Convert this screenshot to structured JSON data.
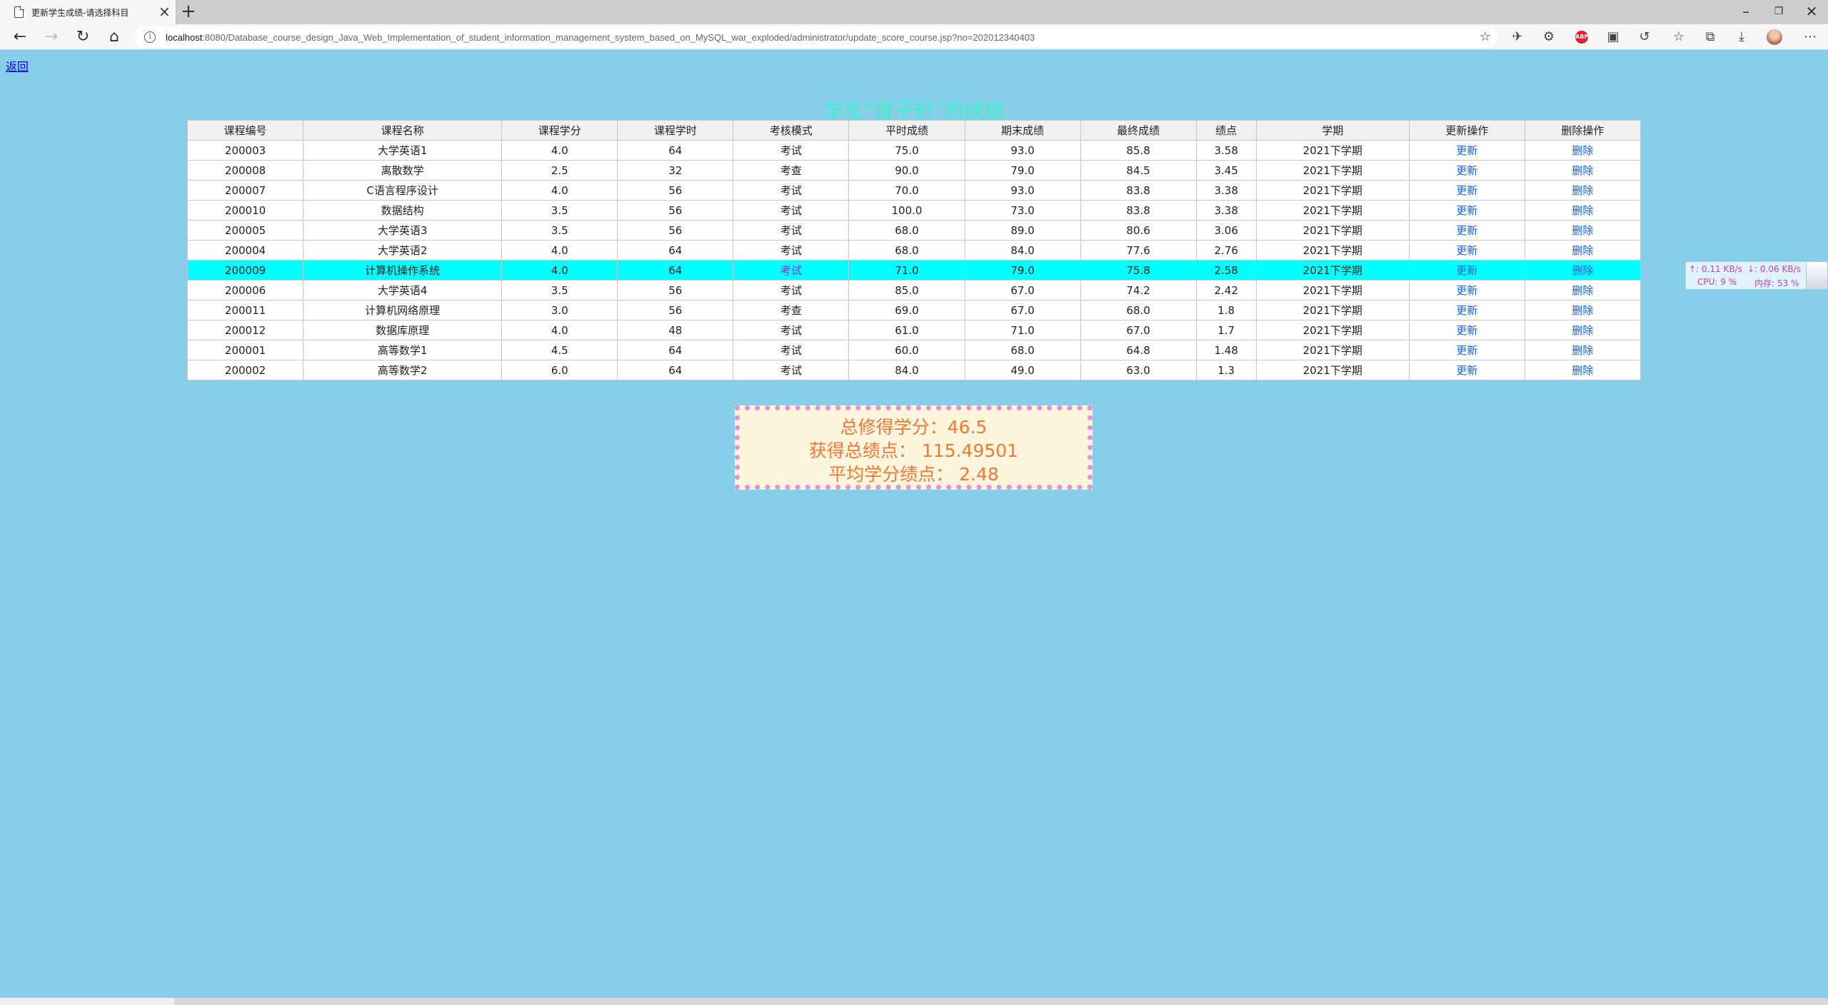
{
  "browser": {
    "tab_title": "更新学生成绩-请选择科目",
    "url_host": "localhost",
    "url_path": ":8080/Database_course_design_Java_Web_Implementation_of_student_information_management_system_based_on_MySQL_war_exploded/administrator/update_score_course.jsp?no=202012340403",
    "icons": [
      "back-arrow-icon",
      "forward-arrow-icon",
      "reload-icon",
      "home-icon",
      "info-icon",
      "favorite-star-icon",
      "extension-icon",
      "adblock-icon",
      "collections-icon",
      "refresh-icon",
      "favorites-icon",
      "downloads-icon",
      "menu-icon"
    ]
  },
  "page": {
    "back_label": "返回",
    "heading": "学生“曾子轩”的成绩"
  },
  "table": {
    "headers": [
      "课程编号",
      "课程名称",
      "课程学分",
      "课程学时",
      "考核模式",
      "平时成绩",
      "期末成绩",
      "最终成绩",
      "绩点",
      "学期",
      "更新操作",
      "删除操作"
    ],
    "rows": [
      {
        "id": "200003",
        "name": "大学英语1",
        "credit": "4.0",
        "hours": "64",
        "mode": "考试",
        "usual": "75.0",
        "final": "93.0",
        "total": "85.8",
        "gpa": "3.58",
        "term": "2021下学期",
        "update": "更新",
        "delete": "删除"
      },
      {
        "id": "200008",
        "name": "离散数学",
        "credit": "2.5",
        "hours": "32",
        "mode": "考查",
        "usual": "90.0",
        "final": "79.0",
        "total": "84.5",
        "gpa": "3.45",
        "term": "2021下学期",
        "update": "更新",
        "delete": "删除"
      },
      {
        "id": "200007",
        "name": "C语言程序设计",
        "credit": "4.0",
        "hours": "56",
        "mode": "考试",
        "usual": "70.0",
        "final": "93.0",
        "total": "83.8",
        "gpa": "3.38",
        "term": "2021下学期",
        "update": "更新",
        "delete": "删除"
      },
      {
        "id": "200010",
        "name": "数据结构",
        "credit": "3.5",
        "hours": "56",
        "mode": "考试",
        "usual": "100.0",
        "final": "73.0",
        "total": "83.8",
        "gpa": "3.38",
        "term": "2021下学期",
        "update": "更新",
        "delete": "删除"
      },
      {
        "id": "200005",
        "name": "大学英语3",
        "credit": "3.5",
        "hours": "56",
        "mode": "考试",
        "usual": "68.0",
        "final": "89.0",
        "total": "80.6",
        "gpa": "3.06",
        "term": "2021下学期",
        "update": "更新",
        "delete": "删除"
      },
      {
        "id": "200004",
        "name": "大学英语2",
        "credit": "4.0",
        "hours": "64",
        "mode": "考试",
        "usual": "68.0",
        "final": "84.0",
        "total": "77.6",
        "gpa": "2.76",
        "term": "2021下学期",
        "update": "更新",
        "delete": "删除"
      },
      {
        "id": "200009",
        "name": "计算机操作系统",
        "credit": "4.0",
        "hours": "64",
        "mode": "考试",
        "usual": "71.0",
        "final": "79.0",
        "total": "75.8",
        "gpa": "2.58",
        "term": "2021下学期",
        "update": "更新",
        "delete": "删除"
      },
      {
        "id": "200006",
        "name": "大学英语4",
        "credit": "3.5",
        "hours": "56",
        "mode": "考试",
        "usual": "85.0",
        "final": "67.0",
        "total": "74.2",
        "gpa": "2.42",
        "term": "2021下学期",
        "update": "更新",
        "delete": "删除"
      },
      {
        "id": "200011",
        "name": "计算机网络原理",
        "credit": "3.0",
        "hours": "56",
        "mode": "考查",
        "usual": "69.0",
        "final": "67.0",
        "total": "68.0",
        "gpa": "1.8",
        "term": "2021下学期",
        "update": "更新",
        "delete": "删除"
      },
      {
        "id": "200012",
        "name": "数据库原理",
        "credit": "4.0",
        "hours": "48",
        "mode": "考试",
        "usual": "61.0",
        "final": "71.0",
        "total": "67.0",
        "gpa": "1.7",
        "term": "2021下学期",
        "update": "更新",
        "delete": "删除"
      },
      {
        "id": "200001",
        "name": "高等数学1",
        "credit": "4.5",
        "hours": "64",
        "mode": "考试",
        "usual": "60.0",
        "final": "68.0",
        "total": "64.8",
        "gpa": "1.48",
        "term": "2021下学期",
        "update": "更新",
        "delete": "删除"
      },
      {
        "id": "200002",
        "name": "高等数学2",
        "credit": "6.0",
        "hours": "64",
        "mode": "考试",
        "usual": "84.0",
        "final": "49.0",
        "total": "63.0",
        "gpa": "1.3",
        "term": "2021下学期",
        "update": "更新",
        "delete": "删除"
      }
    ],
    "highlighted_row_id": "200009"
  },
  "summary": {
    "total_credit": "总修得学分：46.5",
    "total_gpa": "获得总绩点： 115.49501",
    "avg_gpa": "平均学分绩点： 2.48"
  },
  "netspeed": {
    "up": "↑: 0.11 KB/s",
    "down": "↓: 0.06 KB/s",
    "cpu": "CPU: 9 %",
    "mem": "内存: 53 %"
  },
  "colors": {
    "page_bg": "#87ceeb",
    "heading": "#3ff0c9",
    "highlight_row": "#00ffff",
    "link": "#1a5fd8",
    "summary_text": "#f07838",
    "summary_bg": "#fdf5dc",
    "summary_border": "#e690d8"
  }
}
